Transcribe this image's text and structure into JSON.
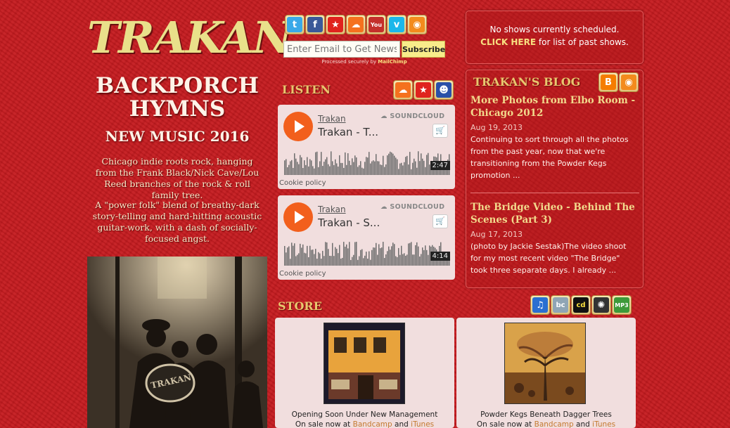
{
  "logo": {
    "text": "TRAKAN"
  },
  "album": {
    "title_line1": "BACKPORCH",
    "title_line2": "HYMNS",
    "subtitle": "NEW MUSIC 2016"
  },
  "bio": [
    "Chicago indie roots rock, hanging from the Frank Black/Nick Cave/Lou Reed branches of the rock & roll family tree.",
    "A \"power folk\" blend of breathy-dark story-telling and hard-hitting acoustic guitar-work, with a dash of socially-focused angst."
  ],
  "band_photo": {
    "label": "TRAKAN"
  },
  "social": [
    {
      "name": "twitter-icon",
      "glyph": "t",
      "color": "#3aa9e8"
    },
    {
      "name": "facebook-icon",
      "glyph": "f",
      "color": "#3b5998"
    },
    {
      "name": "reverbnation-icon",
      "glyph": "★",
      "color": "#e0231e"
    },
    {
      "name": "soundcloud-icon",
      "glyph": "☁",
      "color": "#f5711e"
    },
    {
      "name": "youtube-icon",
      "glyph": "You",
      "color": "#c4302b"
    },
    {
      "name": "vimeo-icon",
      "glyph": "v",
      "color": "#1ab7ea"
    },
    {
      "name": "rss-icon",
      "glyph": "◉",
      "color": "#f38b1d"
    }
  ],
  "newsletter": {
    "placeholder": "Enter Email to Get News",
    "subscribe_label": "Subscribe",
    "processed_prefix": "Processed securely by",
    "processed_brand": "MailChimp"
  },
  "listen": {
    "heading": "LISTEN",
    "icons": [
      {
        "name": "soundcloud-icon",
        "glyph": "☁",
        "color": "#f5711e"
      },
      {
        "name": "reverbnation-icon",
        "glyph": "★",
        "color": "#e0231e"
      },
      {
        "name": "myspace-icon",
        "glyph": "☻",
        "color": "#2a50a8"
      }
    ],
    "players": [
      {
        "artist": "Trakan",
        "track": "Trakan - T...",
        "brand": "SOUNDCLOUD",
        "duration": "2:47",
        "cookie": "Cookie policy"
      },
      {
        "artist": "Trakan",
        "track": "Trakan - S...",
        "brand": "SOUNDCLOUD",
        "duration": "4:14",
        "cookie": "Cookie policy"
      }
    ]
  },
  "shows": {
    "none_text": "No shows currently scheduled.",
    "click_here": "CLICK HERE",
    "past_suffix": "for list of past shows."
  },
  "blog": {
    "heading": "TRAKAN'S BLOG",
    "posts": [
      {
        "title": "More Photos from Elbo Room - Chicago 2012",
        "date": "Aug 19, 2013",
        "excerpt": "Continuing to sort through all the photos from the past year, now that we're transitioning from the Powder Kegs promotion ..."
      },
      {
        "title": "The Bridge Video - Behind The Scenes (Part 3)",
        "date": "Aug 17, 2013",
        "excerpt": "(photo by Jackie Sestak)The video shoot for my most recent video \"The Bridge\" took three separate days.  I already ..."
      }
    ]
  },
  "store": {
    "heading": "STORE",
    "icons": [
      {
        "name": "itunes-icon",
        "glyph": "♫",
        "color": "#2a6fd1"
      },
      {
        "name": "bandcamp-icon",
        "glyph": "bc",
        "color": "#8fa5b5"
      },
      {
        "name": "cdbaby-icon",
        "glyph": "cd",
        "color": "#111111"
      },
      {
        "name": "reverbnation-store-icon",
        "glyph": "✺",
        "color": "#333333"
      },
      {
        "name": "amazon-mp3-icon",
        "glyph": "MP3",
        "color": "#3d9a3a"
      }
    ],
    "albums": [
      {
        "name": "Opening Soon Under New Management",
        "sale_prefix": "On sale now at",
        "link1": "Bandcamp",
        "and": "and",
        "link2": "iTunes"
      },
      {
        "name": "Powder Kegs Beneath Dagger Trees",
        "sale_prefix": "On sale now at",
        "link1": "Bandcamp",
        "and": "and",
        "link2": "iTunes"
      }
    ]
  }
}
